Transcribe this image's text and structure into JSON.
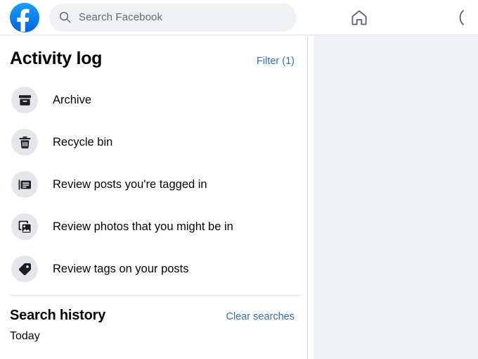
{
  "header": {
    "logo_name": "facebook-logo",
    "logo_color": "#1877f2",
    "search": {
      "placeholder": "Search Facebook",
      "value": "",
      "icon": "search-icon"
    },
    "nav": [
      {
        "name": "home",
        "icon": "home-icon",
        "label": "Home"
      },
      {
        "name": "partial",
        "icon": "partial-icon",
        "label": ""
      }
    ]
  },
  "panel": {
    "title": "Activity log",
    "filter_label": "Filter (1)",
    "filter_color": "#3a6bb5",
    "items": [
      {
        "label": "Archive",
        "icon": "archive-box-icon",
        "name": "archive"
      },
      {
        "label": "Recycle bin",
        "icon": "trash-bin-icon",
        "name": "recycle-bin"
      },
      {
        "label": "Review posts you're tagged in",
        "icon": "posts-review-icon",
        "name": "review-posts-tagged"
      },
      {
        "label": "Review photos that you might be in",
        "icon": "photos-stack-icon",
        "name": "review-photos"
      },
      {
        "label": "Review tags on your posts",
        "icon": "tag-icon",
        "name": "review-tags"
      }
    ],
    "search_history": {
      "title": "Search history",
      "clear_label": "Clear searches",
      "clear_color": "#3a6bb5",
      "day_label": "Today"
    }
  }
}
